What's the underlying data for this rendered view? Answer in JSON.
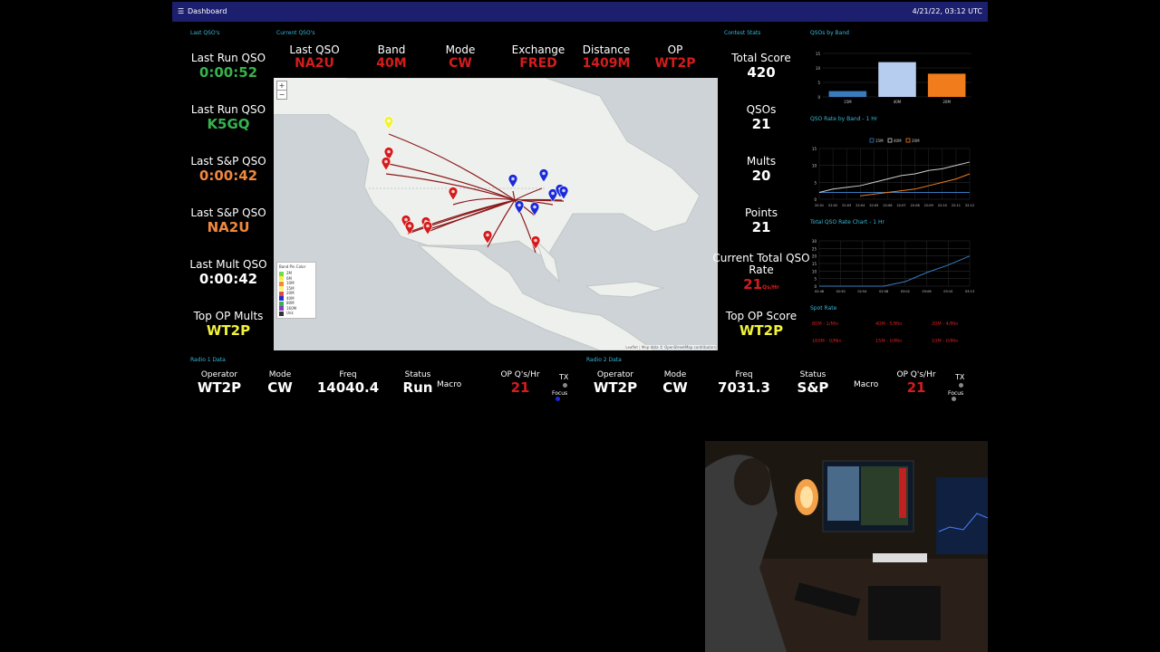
{
  "topbar": {
    "menu_icon": "hamburger-icon",
    "title": "Dashboard",
    "time": "4/21/22, 03:12 UTC"
  },
  "sections": {
    "last": "Last QSO's",
    "current": "Current QSO's",
    "contest": "Contest Stats",
    "bands": "QSOs by Band",
    "rate": "QSO Rate by Band - 1 Hr",
    "total": "Total QSO Rate Chart - 1 Hr",
    "spot": "Spot Rate",
    "radio1": "Radio 1 Data",
    "radio2": "Radio 2 Data"
  },
  "last": [
    {
      "label": "Last Run QSO",
      "value": "0:00:52"
    },
    {
      "label": "Last Run QSO",
      "value": "K5GQ"
    },
    {
      "label": "Last S&P QSO",
      "value": "0:00:42"
    },
    {
      "label": "Last S&P QSO",
      "value": "NA2U"
    },
    {
      "label": "Last Mult QSO",
      "value": "0:00:42"
    },
    {
      "label": "Top OP Mults",
      "value": "WT2P"
    }
  ],
  "current": [
    {
      "label": "Last QSO",
      "value": "NA2U"
    },
    {
      "label": "Band",
      "value": "40M"
    },
    {
      "label": "Mode",
      "value": "CW"
    },
    {
      "label": "Exchange",
      "value": "FRED"
    },
    {
      "label": "Distance",
      "value": "1409M"
    },
    {
      "label": "OP",
      "value": "WT2P"
    }
  ],
  "contest": [
    {
      "label": "Total Score",
      "value": "420"
    },
    {
      "label": "QSOs",
      "value": "21"
    },
    {
      "label": "Mults",
      "value": "20"
    },
    {
      "label": "Points",
      "value": "21"
    },
    {
      "label": "Current Total QSO Rate",
      "value": "21",
      "unit": "Qs/Hr"
    },
    {
      "label": "Top OP Score",
      "value": "WT2P"
    }
  ],
  "map": {
    "zoom_in": "+",
    "zoom_out": "−",
    "legend_title": "Band Pin Color",
    "legend": [
      {
        "label": "2M",
        "color": "#6fdc4a"
      },
      {
        "label": "6M",
        "color": "#f2f23a"
      },
      {
        "label": "10M",
        "color": "#f0883e"
      },
      {
        "label": "15M",
        "color": "#f7f56a"
      },
      {
        "label": "20M",
        "color": "#e04a3c"
      },
      {
        "label": "40M",
        "color": "#2030d0"
      },
      {
        "label": "80M",
        "color": "#37b24d"
      },
      {
        "label": "160M",
        "color": "#8a3fc0"
      },
      {
        "label": "Unk",
        "color": "#333333"
      }
    ],
    "attribution": "Leaflet | Map data © OpenStreetMap contributors"
  },
  "chart_data": [
    {
      "type": "bar",
      "title": "QSOs by Band",
      "categories": [
        "15M",
        "40M",
        "20M"
      ],
      "values": [
        2,
        12,
        8
      ],
      "colors": [
        "#3a7bbf",
        "#b7cdf0",
        "#f07c1c"
      ],
      "ylim": [
        0,
        15
      ],
      "yticks": [
        0,
        5,
        10,
        15
      ]
    },
    {
      "type": "line",
      "title": "QSO Rate by Band - 1 Hr",
      "x": [
        "22:01",
        "22:02",
        "22:03",
        "22:04",
        "22:05",
        "22:06",
        "22:07",
        "22:08",
        "22:09",
        "22:10",
        "22:11",
        "22:12"
      ],
      "series": [
        {
          "name": "15M",
          "color": "#3a7bbf",
          "values": [
            2,
            2,
            2,
            2,
            2,
            2,
            2,
            2,
            2,
            2,
            2,
            2
          ]
        },
        {
          "name": "40M",
          "color": "#cccccc",
          "values": [
            2,
            3,
            3.5,
            4,
            5,
            6,
            7,
            7.5,
            8.5,
            9,
            10,
            11
          ]
        },
        {
          "name": "20M",
          "color": "#f07c1c",
          "values": [
            null,
            null,
            null,
            1,
            1.5,
            2,
            2.5,
            3,
            4,
            5,
            6,
            7.5
          ]
        }
      ],
      "ylim": [
        0,
        15
      ],
      "yticks": [
        0,
        5,
        10,
        15
      ],
      "legend": "top"
    },
    {
      "type": "line",
      "title": "Total QSO Rate Chart - 1 Hr",
      "x": [
        "02:46",
        "02:50",
        "02:54",
        "02:58",
        "03:02",
        "03:06",
        "03:10",
        "03:13"
      ],
      "series": [
        {
          "name": "Total",
          "color": "#3a7bbf",
          "values": [
            0,
            0,
            0,
            0,
            3,
            9,
            14,
            20
          ]
        }
      ],
      "ylim": [
        0,
        30
      ],
      "yticks": [
        0,
        5,
        10,
        15,
        20,
        25,
        30
      ]
    }
  ],
  "spots": [
    "80M - 1/Min",
    "40M - 5/Min",
    "20M - 4/Min",
    "160M - 0/Min",
    "15M - 0/Min",
    "10M - 0/Min"
  ],
  "radio1": {
    "operator_label": "Operator",
    "operator": "WT2P",
    "mode_label": "Mode",
    "mode": "CW",
    "freq_label": "Freq",
    "freq": "14040.4",
    "status_label": "Status",
    "status": "Run",
    "macro_label": "Macro",
    "rate_label": "OP Q's/Hr",
    "rate": "21",
    "tx_label": "TX",
    "focus_label": "Focus"
  },
  "radio2": {
    "operator_label": "Operator",
    "operator": "WT2P",
    "mode_label": "Mode",
    "mode": "CW",
    "freq_label": "Freq",
    "freq": "7031.3",
    "status_label": "Status",
    "status": "S&P",
    "macro_label": "Macro",
    "rate_label": "OP Q's/Hr",
    "rate": "21",
    "tx_label": "TX",
    "focus_label": "Focus"
  }
}
